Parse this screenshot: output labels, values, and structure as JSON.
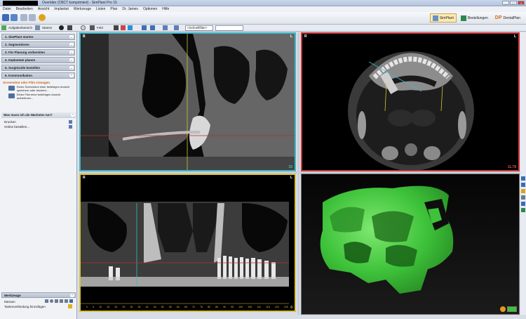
{
  "window": {
    "title": "Overbiter (CBCT komprimiert) - SimPlant Pro 15",
    "buttons": [
      "_",
      "□",
      "×"
    ]
  },
  "menu": [
    "Datei",
    "Bearbeiten",
    "Ansicht",
    "Implantat",
    "Werkzeuge",
    "Listen",
    "Plan",
    "Dr. James",
    "Optionen",
    "Hilfe"
  ],
  "toolbar": {
    "tabs": [
      {
        "label": "SimPlant",
        "active": true
      },
      {
        "label": "Bestellungen",
        "active": false
      },
      {
        "label": "DentalPlan",
        "active": false
      }
    ]
  },
  "toolbar2": {
    "task_area": "Aufgabenbereich",
    "stamp": "Stamm",
    "field": "Feld",
    "quick_filter": "<Schnellfilter>"
  },
  "sidebar": {
    "steps": [
      "1. SimPlant starten",
      "2. Segmentieren",
      "3. Für Planung vorbereiten",
      "4. Implantate planen",
      "5. SurgiGuide bestellen",
      "6. Kommunikation"
    ],
    "screenshot_title": "Screenshot oder Film erzeugen",
    "sub_items": [
      "Einen Screenshot einer beliebigen Ansicht speichern oder drucken...",
      "Einen Film einer beliebigen Ansicht aufnehmen..."
    ],
    "next_question": "Was muss ich als Nächstes tun?",
    "quick_items": [
      "Drucken",
      "Online bestellen..."
    ],
    "tools_title": "Werkzeuge",
    "tools_items": [
      "Messen",
      "Tastenverbindung hinzufügen"
    ]
  },
  "viewports": {
    "top_left": {
      "orientation_left": "B",
      "orientation_right": "L",
      "slice": "33"
    },
    "top_right": {
      "orientation_left": "R",
      "orientation_right": "L",
      "slice": "11.78"
    },
    "bottom_left": {
      "orientation_left": "R",
      "orientation_right": "L",
      "slice": "0",
      "ruler": [
        "0",
        "5",
        "10",
        "15",
        "20",
        "25",
        "30",
        "35",
        "40",
        "45",
        "50",
        "55",
        "60",
        "65",
        "70",
        "75",
        "80",
        "85",
        "90",
        "95",
        "100",
        "105",
        "110",
        "115",
        "120",
        "125"
      ]
    }
  },
  "colors": {
    "axial_border": "#c93939",
    "sagittal_border": "#3fb7c8",
    "panoramic_border": "#d9c33a",
    "model_green": "#3ec23a",
    "step_orange": "#c7631a"
  }
}
